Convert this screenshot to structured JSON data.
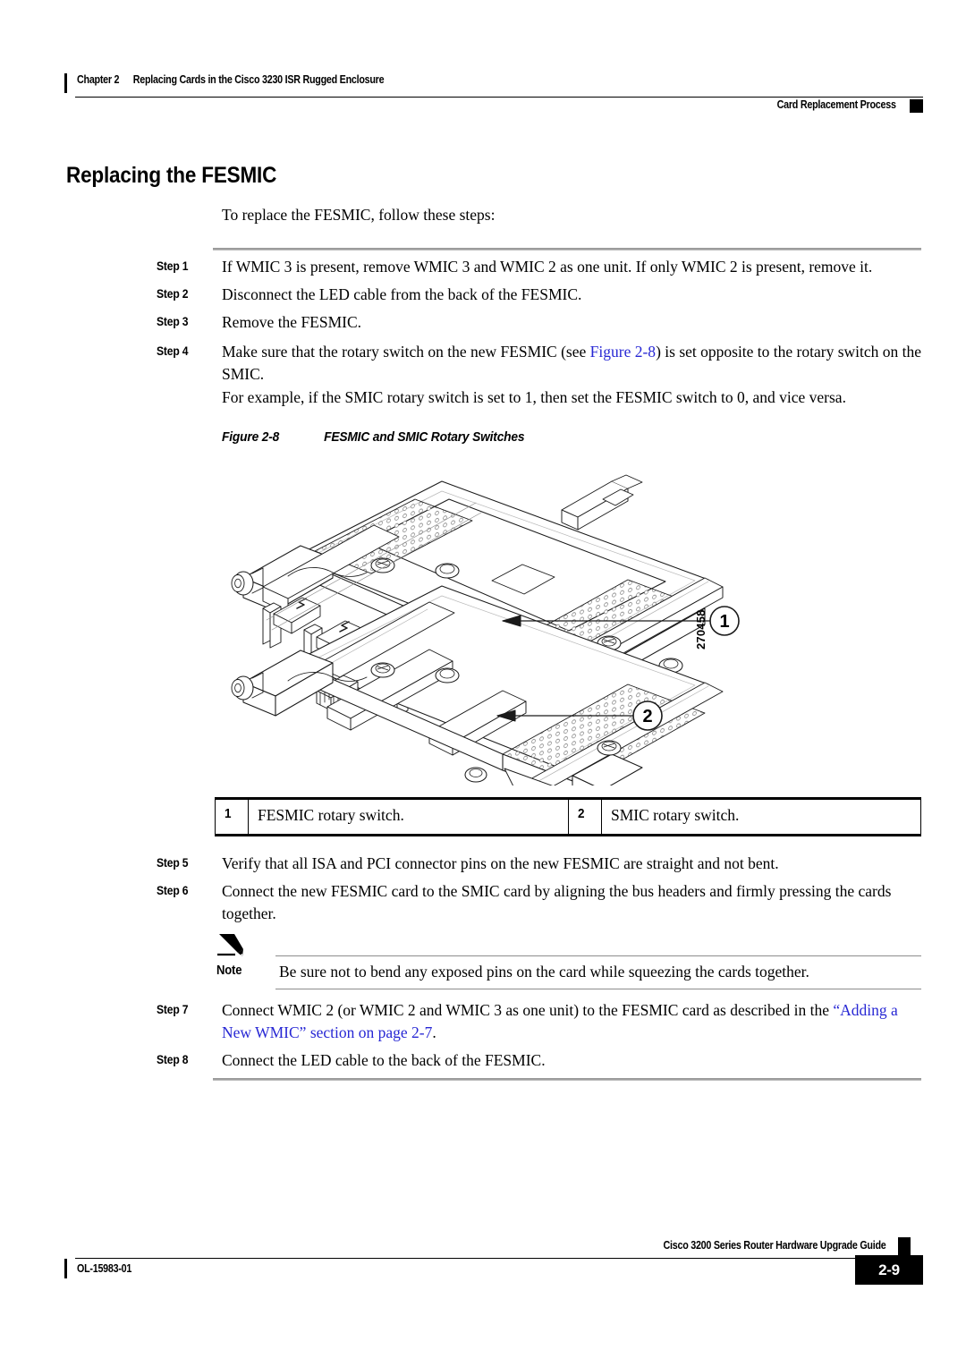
{
  "header": {
    "chapter_num": "Chapter 2",
    "chapter_title": "Replacing Cards in the Cisco 3230 ISR Rugged Enclosure",
    "section": "Card Replacement Process"
  },
  "section": {
    "title": "Replacing the FESMIC",
    "intro": "To replace the FESMIC, follow these steps:"
  },
  "steps": [
    {
      "label": "Step 1",
      "text": "If WMIC 3 is present, remove WMIC 3 and WMIC 2 as one unit. If only WMIC 2 is present, remove it."
    },
    {
      "label": "Step 2",
      "text": "Disconnect the LED cable from the back of the FESMIC."
    },
    {
      "label": "Step 3",
      "text": "Remove the FESMIC."
    },
    {
      "label": "Step 4",
      "text_before_link": "Make sure that the rotary switch on the new FESMIC (see ",
      "link": "Figure 2-8",
      "text_after_link": ") is set opposite to the rotary switch on the SMIC.",
      "extra": "For example, if the SMIC rotary switch is set to 1, then set the FESMIC switch to 0, and vice versa."
    },
    {
      "label": "Step 5",
      "text": "Verify that all ISA and PCI connector pins on the new FESMIC are straight and not bent."
    },
    {
      "label": "Step 6",
      "text": "Connect the new FESMIC card to the SMIC card by aligning the bus headers and firmly pressing the cards together."
    },
    {
      "label": "Step 7",
      "text_before_link": "Connect WMIC 2 (or WMIC 2 and WMIC 3 as one unit) to the FESMIC card as described in the ",
      "link": "“Adding a New WMIC” section on page 2-7",
      "text_after_link": "."
    },
    {
      "label": "Step 8",
      "text": "Connect the LED cable to the back of the FESMIC."
    }
  ],
  "figure": {
    "caption_number": "Figure 2-8",
    "caption_title": "FESMIC and SMIC Rotary Switches",
    "artwork_id": "270458",
    "callouts": [
      {
        "number": "1"
      },
      {
        "number": "2"
      }
    ]
  },
  "legend": {
    "items": [
      {
        "number": "1",
        "text": "FESMIC rotary switch."
      },
      {
        "number": "2",
        "text": "SMIC rotary switch."
      }
    ]
  },
  "note": {
    "label": "Note",
    "text": "Be sure not to bend any exposed pins on the card while squeezing the cards together."
  },
  "footer": {
    "doc_id": "OL-15983-01",
    "guide_title": "Cisco 3200 Series Router Hardware Upgrade Guide",
    "page_number": "2-9"
  },
  "colors": {
    "link": "#2727d4",
    "rule": "#9a9a9a",
    "ink": "#000000"
  }
}
